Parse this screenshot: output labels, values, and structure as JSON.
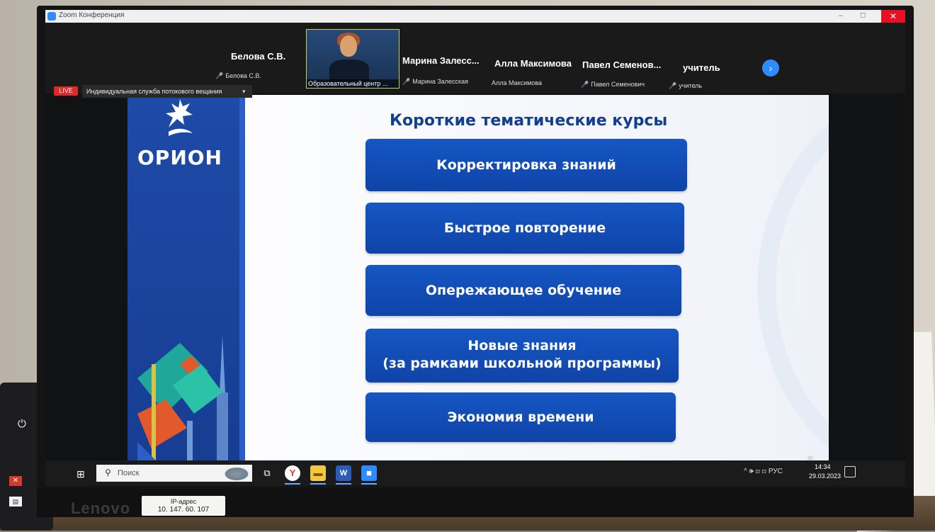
{
  "window": {
    "title": "Zoom Конференция",
    "close_label": "✕",
    "min_label": "–",
    "max_label": "◻"
  },
  "participants": [
    {
      "name": "Белова С.В.",
      "sub": "Белова С.В."
    },
    {
      "name": "Марина Залесс...",
      "sub": "Марина Залесская"
    },
    {
      "name": "Алла Максимова",
      "sub": "Алла Максимова"
    },
    {
      "name": "Павел Семенов...",
      "sub": "Павел Семенович"
    },
    {
      "name": "учитель",
      "sub": "учитель"
    }
  ],
  "video_tile": {
    "label": "Образовательный центр ..."
  },
  "live": {
    "badge": "LIVE",
    "stream_text": "Индивидуальная служба потокового вещания"
  },
  "slide": {
    "logo_text": "ОРИОН",
    "title": "Короткие тематические курсы",
    "courses": [
      {
        "line1": "Корректировка знаний"
      },
      {
        "line1": "Быстрое повторение"
      },
      {
        "line1": "Опережающее обучение"
      },
      {
        "line1": "Новые знания",
        "line2": "(за рамками школьной программы)"
      },
      {
        "line1": "Экономия времени"
      }
    ],
    "page_number": "30"
  },
  "taskbar": {
    "search_placeholder": "Поиск",
    "tray_text": "^ 🕪 ⊡ ⊡ РУС",
    "time": "14:34",
    "date": "29.03.2023"
  },
  "hardware": {
    "brand": "Lenovo",
    "ip_label": "IP-адрес",
    "ip_value": "10. 147. 60. 107"
  },
  "icons": [
    "zoom-logo-icon",
    "next-arrow-icon",
    "bird-logo-icon",
    "windows-start-icon",
    "search-icon",
    "task-view-icon",
    "yandex-browser-icon",
    "file-explorer-icon",
    "word-icon",
    "zoom-taskbar-icon",
    "notification-icon",
    "power-icon"
  ],
  "colors": {
    "slide_blue": "#1656c4",
    "live_red": "#e02828",
    "zoom_blue": "#2d8cff"
  }
}
